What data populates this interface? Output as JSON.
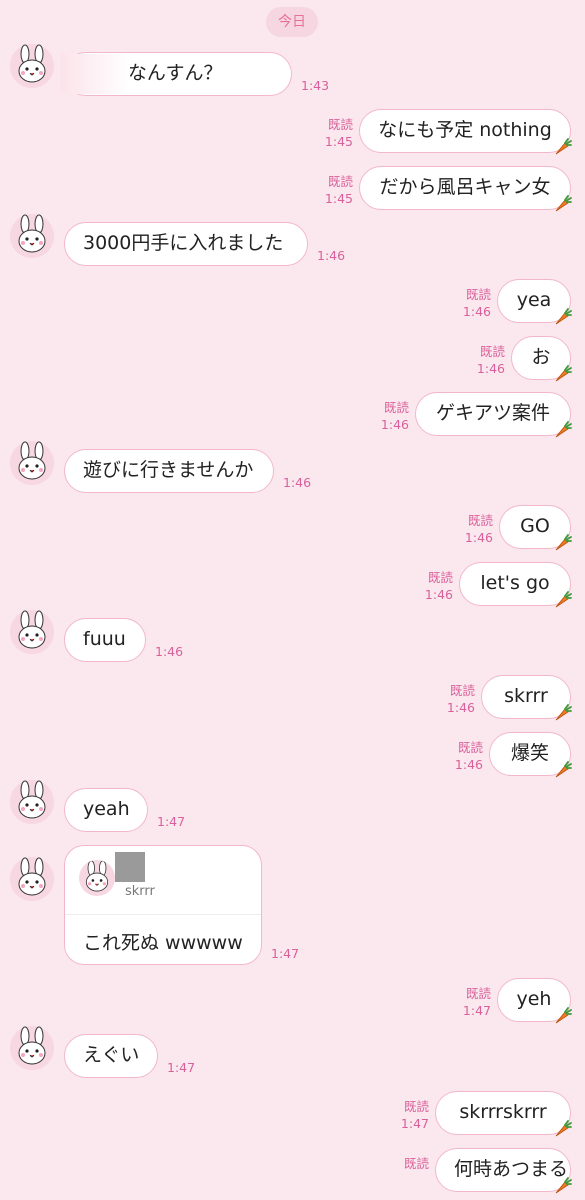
{
  "date_label": "今日",
  "read_label": "既読",
  "icons": {
    "avatar": "bunny-avatar-icon",
    "sticker": "carrot-icon"
  },
  "colors": {
    "background": "#fbe8ef",
    "bubble_border": "#f2b8c9",
    "timestamp": "#d9609a"
  },
  "messages": [
    {
      "dir": "in",
      "text": "-明日なんすん？",
      "time": "1:43"
    },
    {
      "dir": "out",
      "text": "なにも予定 nothing",
      "time": "1:45"
    },
    {
      "dir": "out",
      "text": "だから風呂キャン女",
      "time": "1:45"
    },
    {
      "dir": "in",
      "text": "3000円手に入れました",
      "time": "1:46"
    },
    {
      "dir": "out",
      "text": "yea",
      "time": "1:46"
    },
    {
      "dir": "out",
      "text": "お",
      "time": "1:46"
    },
    {
      "dir": "out",
      "text": "ゲキアツ案件",
      "time": "1:46"
    },
    {
      "dir": "in",
      "text": "遊びに行きませんか",
      "time": "1:46"
    },
    {
      "dir": "out",
      "text": "GO",
      "time": "1:46"
    },
    {
      "dir": "out",
      "text": "let's go",
      "time": "1:46"
    },
    {
      "dir": "in",
      "text": "fuuu",
      "time": "1:46"
    },
    {
      "dir": "out",
      "text": "skrrr",
      "time": "1:46"
    },
    {
      "dir": "out",
      "text": "爆笑",
      "time": "1:46"
    },
    {
      "dir": "in",
      "text": "yeah",
      "time": "1:47"
    },
    {
      "dir": "out",
      "text": "yeh",
      "time": "1:47"
    },
    {
      "dir": "in",
      "text": "えぐい",
      "time": "1:47"
    },
    {
      "dir": "out",
      "text": "skrrrskrrr",
      "time": "1:47"
    },
    {
      "dir": "out",
      "text": "何時あつまる",
      "time": ""
    }
  ],
  "reply": {
    "quoted": "skrrr",
    "text": "これ死ぬ wwwww",
    "time": "1:47"
  }
}
